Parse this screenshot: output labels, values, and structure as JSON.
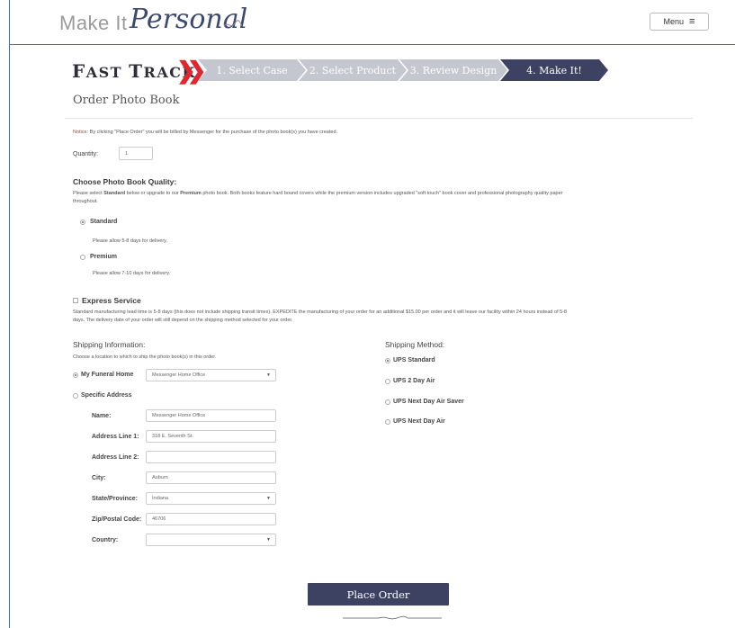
{
  "header": {
    "logo_make": "Make It",
    "logo_personal": "Personal",
    "menu_label": "Menu",
    "menu_icon": "hamburger-icon"
  },
  "fast_track": {
    "label_first": "F",
    "label_rest1": "AST ",
    "label_second": "T",
    "label_rest2": "RACK",
    "chevrons": "❯❯",
    "steps": [
      {
        "label": "1. Select Case",
        "color": "#c4c6d0"
      },
      {
        "label": "2. Select Product",
        "color": "#c4c6d0"
      },
      {
        "label": "3. Review Design",
        "color": "#c4c6d0"
      },
      {
        "label": "4. Make It!",
        "color": "#3d4262"
      }
    ]
  },
  "page_title": "Order Photo Book",
  "notice": {
    "prefix": "Notice:",
    "text": " By clicking \"Place Order\" you will be billed by Messenger for the purchase of the photo book(s) you have created."
  },
  "quantity": {
    "label": "Quantity:",
    "value": "1"
  },
  "quality": {
    "heading": "Choose Photo Book Quality:",
    "description_1": "Please select ",
    "description_std": "Standard",
    "description_2": " below or upgrade to our ",
    "description_prem": "Premium",
    "description_3": " photo book. Both books feature hard bound covers while the premium version includes upgraded \"soft touch\" book cover and professional photography quality paper",
    "description_4": "throughout.",
    "options": [
      {
        "label": "Standard",
        "note": "Please allow 5-8 days for delivery.",
        "selected": true
      },
      {
        "label": "Premium",
        "note": "Please allow 7-10 days for delivery.",
        "selected": false
      }
    ]
  },
  "express": {
    "heading": "Express Service",
    "text_1": "Standard manufacturing lead time is 5-8 days (this does not include shipping transit times). EXPEDITE the manufacturing of your order for an additional $15.00 per order and it will leave our facility within 24 hours instead of 5-8",
    "text_2": "days. The delivery date of your order will still depend on the shipping method selected for your order.",
    "checked": false
  },
  "shipping_info": {
    "heading": "Shipping Information:",
    "subtext": "Choose a location to which to ship the photo book(s) in this order.",
    "my_funeral_home_label": "My Funeral Home",
    "my_funeral_home_value": "Messenger Home Office",
    "specific_address_label": "Specific Address",
    "fields": [
      {
        "label": "Name:",
        "value": "Messenger Home Office",
        "type": "text"
      },
      {
        "label": "Address Line 1:",
        "value": "318 E. Seventh St.",
        "type": "text"
      },
      {
        "label": "Address Line 2:",
        "value": "",
        "type": "text"
      },
      {
        "label": "City:",
        "value": "Auburn",
        "type": "text"
      },
      {
        "label": "State/Province:",
        "value": "Indiana",
        "type": "select"
      },
      {
        "label": "Zip/Postal Code:",
        "value": "46706",
        "type": "text"
      },
      {
        "label": "Country:",
        "value": "",
        "type": "select"
      }
    ]
  },
  "shipping_method": {
    "heading": "Shipping Method:",
    "options": [
      {
        "label": "UPS Standard",
        "selected": true
      },
      {
        "label": "UPS 2 Day Air",
        "selected": false
      },
      {
        "label": "UPS Next Day Air Saver",
        "selected": false
      },
      {
        "label": "UPS Next Day Air",
        "selected": false
      }
    ]
  },
  "place_order_label": "Place Order"
}
